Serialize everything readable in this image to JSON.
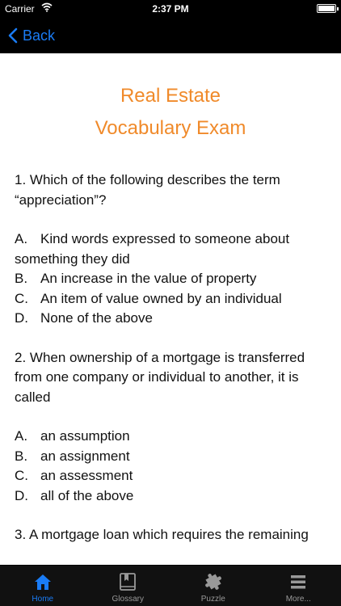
{
  "status": {
    "carrier": "Carrier",
    "time": "2:37 PM"
  },
  "nav": {
    "back_label": "Back"
  },
  "title_line1": "Real Estate",
  "title_line2": "Vocabulary Exam",
  "questions": [
    {
      "text": "1. Which of the following describes the term “appreciation”?",
      "options": [
        {
          "letter": "A.",
          "text": "Kind words expressed to someone about something they did"
        },
        {
          "letter": "B.",
          "text": "An increase in the value of property"
        },
        {
          "letter": "C.",
          "text": "An item of value owned by an individual"
        },
        {
          "letter": "D.",
          "text": "None of the above"
        }
      ]
    },
    {
      "text": "2. When ownership of a mortgage is transferred from one company or individual to another, it is called",
      "options": [
        {
          "letter": "A.",
          "text": "an assumption"
        },
        {
          "letter": "B.",
          "text": "an assignment"
        },
        {
          "letter": "C.",
          "text": "an assessment"
        },
        {
          "letter": "D.",
          "text": "all of the above"
        }
      ]
    },
    {
      "text": "3. A mortgage loan which requires the remaining"
    }
  ],
  "tabs": [
    {
      "label": "Home",
      "icon": "home-icon",
      "active": true
    },
    {
      "label": "Glossary",
      "icon": "book-icon",
      "active": false
    },
    {
      "label": "Puzzle",
      "icon": "puzzle-icon",
      "active": false
    },
    {
      "label": "More...",
      "icon": "menu-icon",
      "active": false
    }
  ],
  "colors": {
    "accent": "#1a7cf5",
    "title": "#f08a2a",
    "bar": "#000000"
  }
}
